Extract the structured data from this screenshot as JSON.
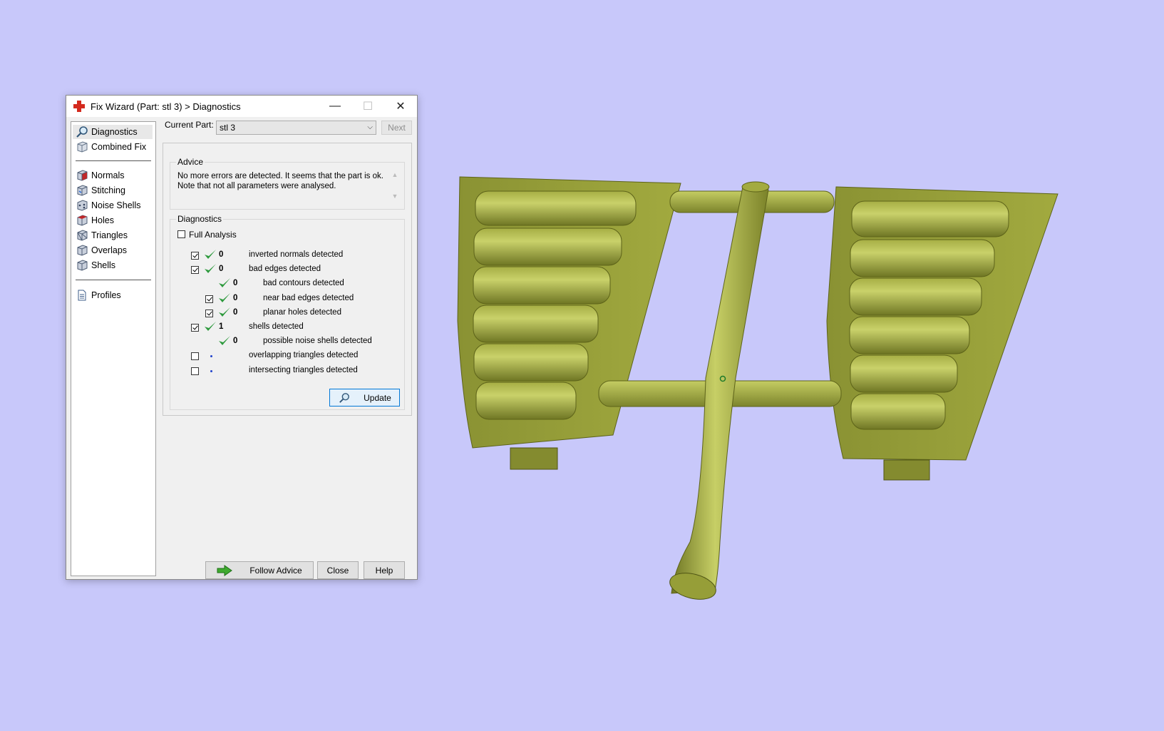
{
  "window": {
    "title": "Fix Wizard (Part: stl 3) > Diagnostics",
    "min_glyph": "—",
    "max_glyph": "☐",
    "close_glyph": "✕"
  },
  "sidebar": {
    "items": [
      {
        "label": "Diagnostics",
        "icon": "magnifier-icon",
        "selected": true
      },
      {
        "label": "Combined Fix",
        "icon": "cube-icon"
      },
      {
        "label": "Normals",
        "icon": "cube-red-icon"
      },
      {
        "label": "Stitching",
        "icon": "cube-stitch-icon"
      },
      {
        "label": "Noise Shells",
        "icon": "noise-cube-icon"
      },
      {
        "label": "Holes",
        "icon": "cube-holes-icon"
      },
      {
        "label": "Triangles",
        "icon": "triangle-cube-icon"
      },
      {
        "label": "Overlaps",
        "icon": "overlap-cube-icon"
      },
      {
        "label": "Shells",
        "icon": "shells-cube-icon"
      },
      {
        "label": "Profiles",
        "icon": "document-icon"
      }
    ]
  },
  "current_part": {
    "label": "Current Part:",
    "value": "stl 3",
    "next_label": "Next"
  },
  "advice": {
    "title": "Advice",
    "lines": [
      "No more errors are detected. It seems that the part is ok.",
      "Note that not all parameters were analysed."
    ]
  },
  "diagnostics": {
    "title": "Diagnostics",
    "full_analysis_label": "Full Analysis",
    "full_analysis_checked": false,
    "rows": [
      {
        "checkbox": true,
        "checked": true,
        "status": "ok",
        "count": "0",
        "label": "inverted normals detected",
        "indent": 0
      },
      {
        "checkbox": true,
        "checked": true,
        "status": "ok",
        "count": "0",
        "label": "bad edges detected",
        "indent": 0
      },
      {
        "checkbox": false,
        "checked": false,
        "status": "ok",
        "count": "0",
        "label": "bad contours detected",
        "indent": 1
      },
      {
        "checkbox": true,
        "checked": true,
        "status": "ok",
        "count": "0",
        "label": "near bad edges detected",
        "indent": 1
      },
      {
        "checkbox": true,
        "checked": true,
        "status": "ok",
        "count": "0",
        "label": "planar holes detected",
        "indent": 1
      },
      {
        "checkbox": true,
        "checked": true,
        "status": "ok",
        "count": "1",
        "label": "shells detected",
        "indent": 0
      },
      {
        "checkbox": false,
        "checked": false,
        "status": "ok",
        "count": "0",
        "label": "possible noise shells detected",
        "indent": 1
      },
      {
        "checkbox": true,
        "checked": false,
        "status": "not-run",
        "count": "",
        "label": "overlapping triangles detected",
        "indent": 0
      },
      {
        "checkbox": true,
        "checked": false,
        "status": "not-run",
        "count": "",
        "label": "intersecting triangles detected",
        "indent": 0
      }
    ],
    "update_label": "Update"
  },
  "footer": {
    "follow_advice_label": "Follow Advice",
    "close_label": "Close",
    "help_label": "Help"
  },
  "colors": {
    "viewport_bg": "#c8c8fa",
    "model_green": "#b4bd50",
    "check_green": "#2e9a3e"
  }
}
